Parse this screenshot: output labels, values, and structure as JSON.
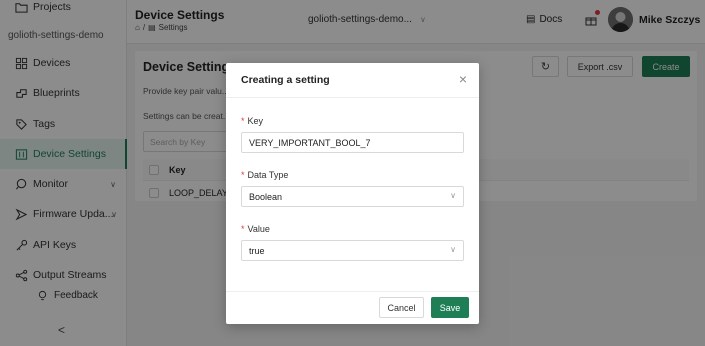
{
  "sidebar": {
    "projects_label": "Projects",
    "project_name": "golioth-settings-demo",
    "items": [
      {
        "label": "Devices",
        "icon": "grid-icon"
      },
      {
        "label": "Blueprints",
        "icon": "blueprint-icon"
      },
      {
        "label": "Tags",
        "icon": "tag-icon"
      },
      {
        "label": "Device Settings",
        "icon": "settings-icon",
        "active": true
      },
      {
        "label": "Monitor",
        "icon": "monitor-icon",
        "expandable": true
      },
      {
        "label": "Firmware Upda...",
        "icon": "firmware-icon",
        "expandable": true
      },
      {
        "label": "API Keys",
        "icon": "key-icon"
      },
      {
        "label": "Output Streams",
        "icon": "share-icon"
      }
    ],
    "feedback_label": "Feedback",
    "collapse_glyph": "<"
  },
  "header": {
    "title": "Device Settings",
    "breadcrumb_label": "Settings",
    "project_selector": "golioth-settings-demo...",
    "docs_label": "Docs",
    "user_name": "Mike Szczys"
  },
  "main": {
    "title": "Device Settings",
    "description": "Provide key pair valu... tile memory, that persists through restarts and power cycles.",
    "description2": "Settings can be creat... vice level.",
    "refresh_icon": "refresh-icon",
    "export_label": "Export .csv",
    "create_label": "Create",
    "search_placeholder": "Search by Key",
    "table": {
      "headers": [
        "Key"
      ],
      "rows": [
        [
          "LOOP_DELAY_..."
        ]
      ]
    }
  },
  "modal": {
    "title": "Creating a setting",
    "key_label": "Key",
    "key_value": "VERY_IMPORTANT_BOOL_7",
    "data_type_label": "Data Type",
    "data_type_value": "Boolean",
    "value_label": "Value",
    "value_value": "true",
    "cancel_label": "Cancel",
    "save_label": "Save"
  },
  "colors": {
    "accent": "#1e7f57",
    "required": "#e03b3b"
  }
}
